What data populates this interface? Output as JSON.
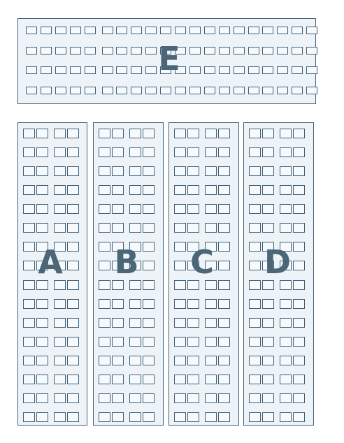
{
  "seating_chart": {
    "colors": {
      "background": "#ffffff",
      "section_fill": "#eef3f8",
      "seat_fill": "#f7fafc",
      "border": "#3f6079",
      "label": "#4b6676"
    },
    "sections": [
      {
        "id": "E",
        "label": "E",
        "rows": 4,
        "seats_per_row": 20
      },
      {
        "id": "A",
        "label": "A",
        "rows": 16,
        "seats_per_row": 4
      },
      {
        "id": "B",
        "label": "B",
        "rows": 16,
        "seats_per_row": 4
      },
      {
        "id": "C",
        "label": "C",
        "rows": 16,
        "seats_per_row": 4
      },
      {
        "id": "D",
        "label": "D",
        "rows": 16,
        "seats_per_row": 4
      }
    ]
  }
}
